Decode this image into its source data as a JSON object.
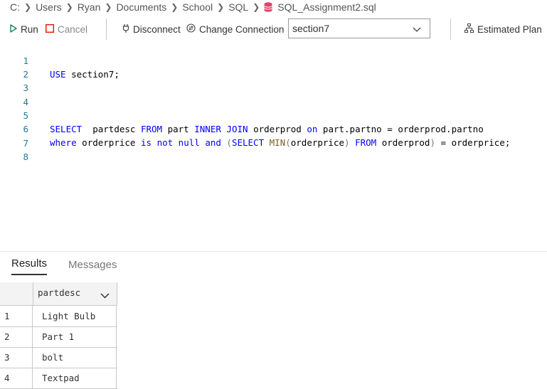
{
  "breadcrumb": {
    "items": [
      "C:",
      "Users",
      "Ryan",
      "Documents",
      "School",
      "SQL"
    ],
    "file": "SQL_Assignment2.sql",
    "separator": ">"
  },
  "toolbar": {
    "run_label": "Run",
    "cancel_label": "Cancel",
    "disconnect_label": "Disconnect",
    "change_connection_label": "Change Connection",
    "database_selected": "section7",
    "estimated_plan_label": "Estimated Plan"
  },
  "editor": {
    "line_numbers": [
      "1",
      "2",
      "3",
      "4",
      "5",
      "6",
      "7",
      "8"
    ],
    "lines": [
      "USE section7;",
      "",
      "",
      "",
      "SELECT  partdesc FROM part INNER JOIN orderprod on part.partno = orderprod.partno",
      "where orderprice is not null and (SELECT MIN(orderprice) FROM orderprod) = orderprice;",
      "",
      ""
    ]
  },
  "results": {
    "tabs": [
      "Results",
      "Messages"
    ],
    "active_tab": "Results",
    "column": "partdesc",
    "rows": [
      {
        "num": "1",
        "value": "Light Bulb"
      },
      {
        "num": "2",
        "value": "Part 1"
      },
      {
        "num": "3",
        "value": "bolt"
      },
      {
        "num": "4",
        "value": "Textpad"
      }
    ]
  },
  "colors": {
    "keyword": "#0000ff",
    "function": "#795e26",
    "line_number": "#237893",
    "run_icon": "#16825d",
    "cancel_icon": "#e51400",
    "file_icon": "#e0436b"
  }
}
